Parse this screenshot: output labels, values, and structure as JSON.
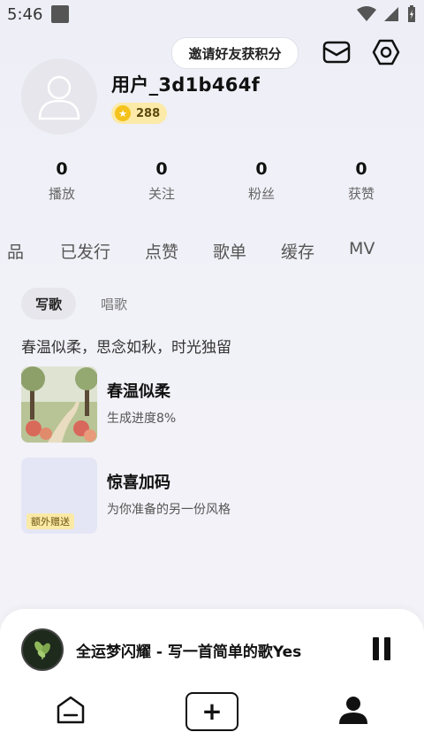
{
  "status_bar": {
    "time": "5:46"
  },
  "header": {
    "invite_label": "邀请好友获积分"
  },
  "profile": {
    "username": "用户_3d1b464f",
    "points": "288"
  },
  "stats": [
    {
      "value": "0",
      "label": "播放"
    },
    {
      "value": "0",
      "label": "关注"
    },
    {
      "value": "0",
      "label": "粉丝"
    },
    {
      "value": "0",
      "label": "获赞"
    }
  ],
  "tabs": [
    "品",
    "已发行",
    "点赞",
    "歌单",
    "缓存",
    "MV"
  ],
  "subtabs": {
    "active": "写歌",
    "other": "唱歌"
  },
  "section_title": "春温似柔，思念如秋，时光独留",
  "songs": [
    {
      "title": "春温似柔",
      "subtitle": "生成进度8%"
    },
    {
      "title": "惊喜加码",
      "subtitle": "为你准备的另一份风格",
      "badge": "额外赠送"
    }
  ],
  "player": {
    "now_playing": "全运梦闪耀 - 写一首简单的歌Yes"
  },
  "colors": {
    "badge_bg": "#fbe9a6",
    "coin": "#f5c21b",
    "background": "#f1f1f8"
  }
}
